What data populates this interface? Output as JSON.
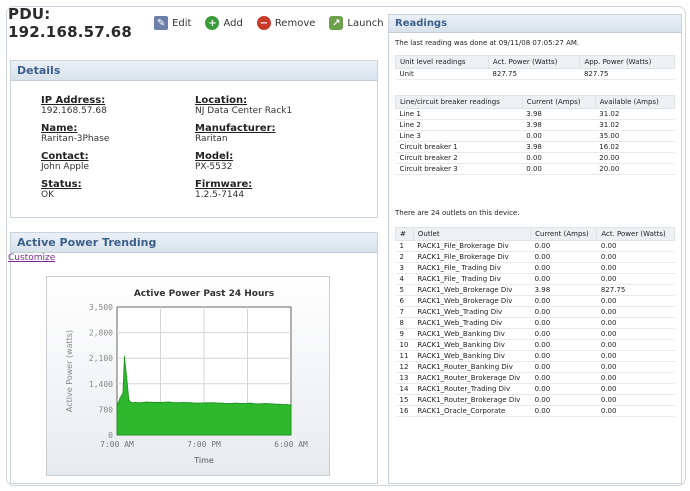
{
  "header": {
    "title": "PDU: 192.168.57.68",
    "actions": [
      {
        "label": "Edit",
        "icon": "edit-icon"
      },
      {
        "label": "Add",
        "icon": "add-icon"
      },
      {
        "label": "Remove",
        "icon": "remove-icon"
      },
      {
        "label": "Launch",
        "icon": "launch-icon"
      }
    ]
  },
  "details": {
    "title": "Details",
    "fields": [
      {
        "label": "IP Address:",
        "value": "192.168.57.68"
      },
      {
        "label": "Location:",
        "value": "NJ Data Center Rack1"
      },
      {
        "label": "Name:",
        "value": "Raritan-3Phase"
      },
      {
        "label": "Manufacturer:",
        "value": "Raritan"
      },
      {
        "label": "Contact:",
        "value": "John Apple"
      },
      {
        "label": "Model:",
        "value": "PX-5532"
      },
      {
        "label": "Status:",
        "value": "OK"
      },
      {
        "label": "Firmware:",
        "value": "1.2.5-7144"
      }
    ]
  },
  "trending": {
    "title": "Active Power Trending",
    "customize_label": "Customize"
  },
  "chart_data": {
    "type": "area",
    "title": "Active Power Past 24 Hours",
    "xlabel": "Time",
    "ylabel": "Active Power (watts)",
    "ylim": [
      0,
      3500
    ],
    "yticks": [
      "0",
      "700",
      "1,400",
      "2,100",
      "2,800",
      "3,500"
    ],
    "xticks": [
      "7:00 AM",
      "7:00 PM",
      "6:00 AM"
    ],
    "grid": true,
    "x": [
      0,
      0.4,
      0.8,
      1.0,
      1.3,
      1.6,
      2.0,
      2.5,
      3,
      4,
      5,
      6,
      7,
      8,
      9,
      10,
      11,
      12,
      13,
      14,
      15,
      16,
      17,
      18,
      19,
      20,
      21,
      22,
      23,
      23.5
    ],
    "values": [
      800,
      1000,
      1150,
      2150,
      1600,
      950,
      880,
      890,
      880,
      900,
      890,
      890,
      900,
      880,
      890,
      880,
      870,
      880,
      880,
      870,
      860,
      870,
      860,
      870,
      850,
      860,
      850,
      840,
      830,
      820
    ],
    "colors": {
      "fill": "#2db82d",
      "stroke": "#1f8f1f"
    }
  },
  "readings": {
    "title": "Readings",
    "last_reading": "The last reading was done at 09/11/08 07:05:27 AM.",
    "unit_headers": [
      "Unit level readings",
      "Act. Power (Watts)",
      "App. Power (Watts)"
    ],
    "unit_rows": [
      [
        "Unit",
        "827.75",
        "827.75"
      ]
    ],
    "line_headers": [
      "Line/circuit breaker readings",
      "Current (Amps)",
      "Available (Amps)"
    ],
    "line_rows": [
      [
        "Line 1",
        "3.98",
        "31.02"
      ],
      [
        "Line 2",
        "3.98",
        "31.02"
      ],
      [
        "Line 3",
        "0.00",
        "35.00"
      ],
      [
        "Circuit breaker 1",
        "3.98",
        "16.02"
      ],
      [
        "Circuit breaker 2",
        "0.00",
        "20.00"
      ],
      [
        "Circuit breaker 3",
        "0.00",
        "20.00"
      ]
    ],
    "outlet_count_text": "There are 24 outlets on this device.",
    "outlet_headers": [
      "#",
      "Outlet",
      "Current (Amps)",
      "Act. Power (Watts)"
    ],
    "outlet_rows": [
      [
        "1",
        "RACK1_File_Brokerage Div",
        "0.00",
        "0.00"
      ],
      [
        "2",
        "RACK1_File_Brokerage Div",
        "0.00",
        "0.00"
      ],
      [
        "3",
        "RACK1_File_ Trading Div",
        "0.00",
        "0.00"
      ],
      [
        "4",
        "RACK1_File_ Trading Div",
        "0.00",
        "0.00"
      ],
      [
        "5",
        "RACK1_Web_Brokerage Div",
        "3.98",
        "827.75"
      ],
      [
        "6",
        "RACK1_Web_Brokerage Div",
        "0.00",
        "0.00"
      ],
      [
        "7",
        "RACK1_Web_Trading Div",
        "0.00",
        "0.00"
      ],
      [
        "8",
        "RACK1_Web_Trading Div",
        "0.00",
        "0.00"
      ],
      [
        "9",
        "RACK1_Web_Banking Div",
        "0.00",
        "0.00"
      ],
      [
        "10",
        "RACK1_Web_Banking Div",
        "0.00",
        "0.00"
      ],
      [
        "11",
        "RACK1_Web_Banking Div",
        "0.00",
        "0.00"
      ],
      [
        "12",
        "RACK1_Router_Banking Div",
        "0.00",
        "0.00"
      ],
      [
        "13",
        "RACK1_Router_Brokerage Div",
        "0.00",
        "0.00"
      ],
      [
        "14",
        "RACK1_Router_Trading Div",
        "0.00",
        "0.00"
      ],
      [
        "15",
        "RACK1_Router_Brokerage Div",
        "0.00",
        "0.00"
      ],
      [
        "16",
        "RACK1_Oracle_Corporate",
        "0.00",
        "0.00"
      ]
    ]
  }
}
